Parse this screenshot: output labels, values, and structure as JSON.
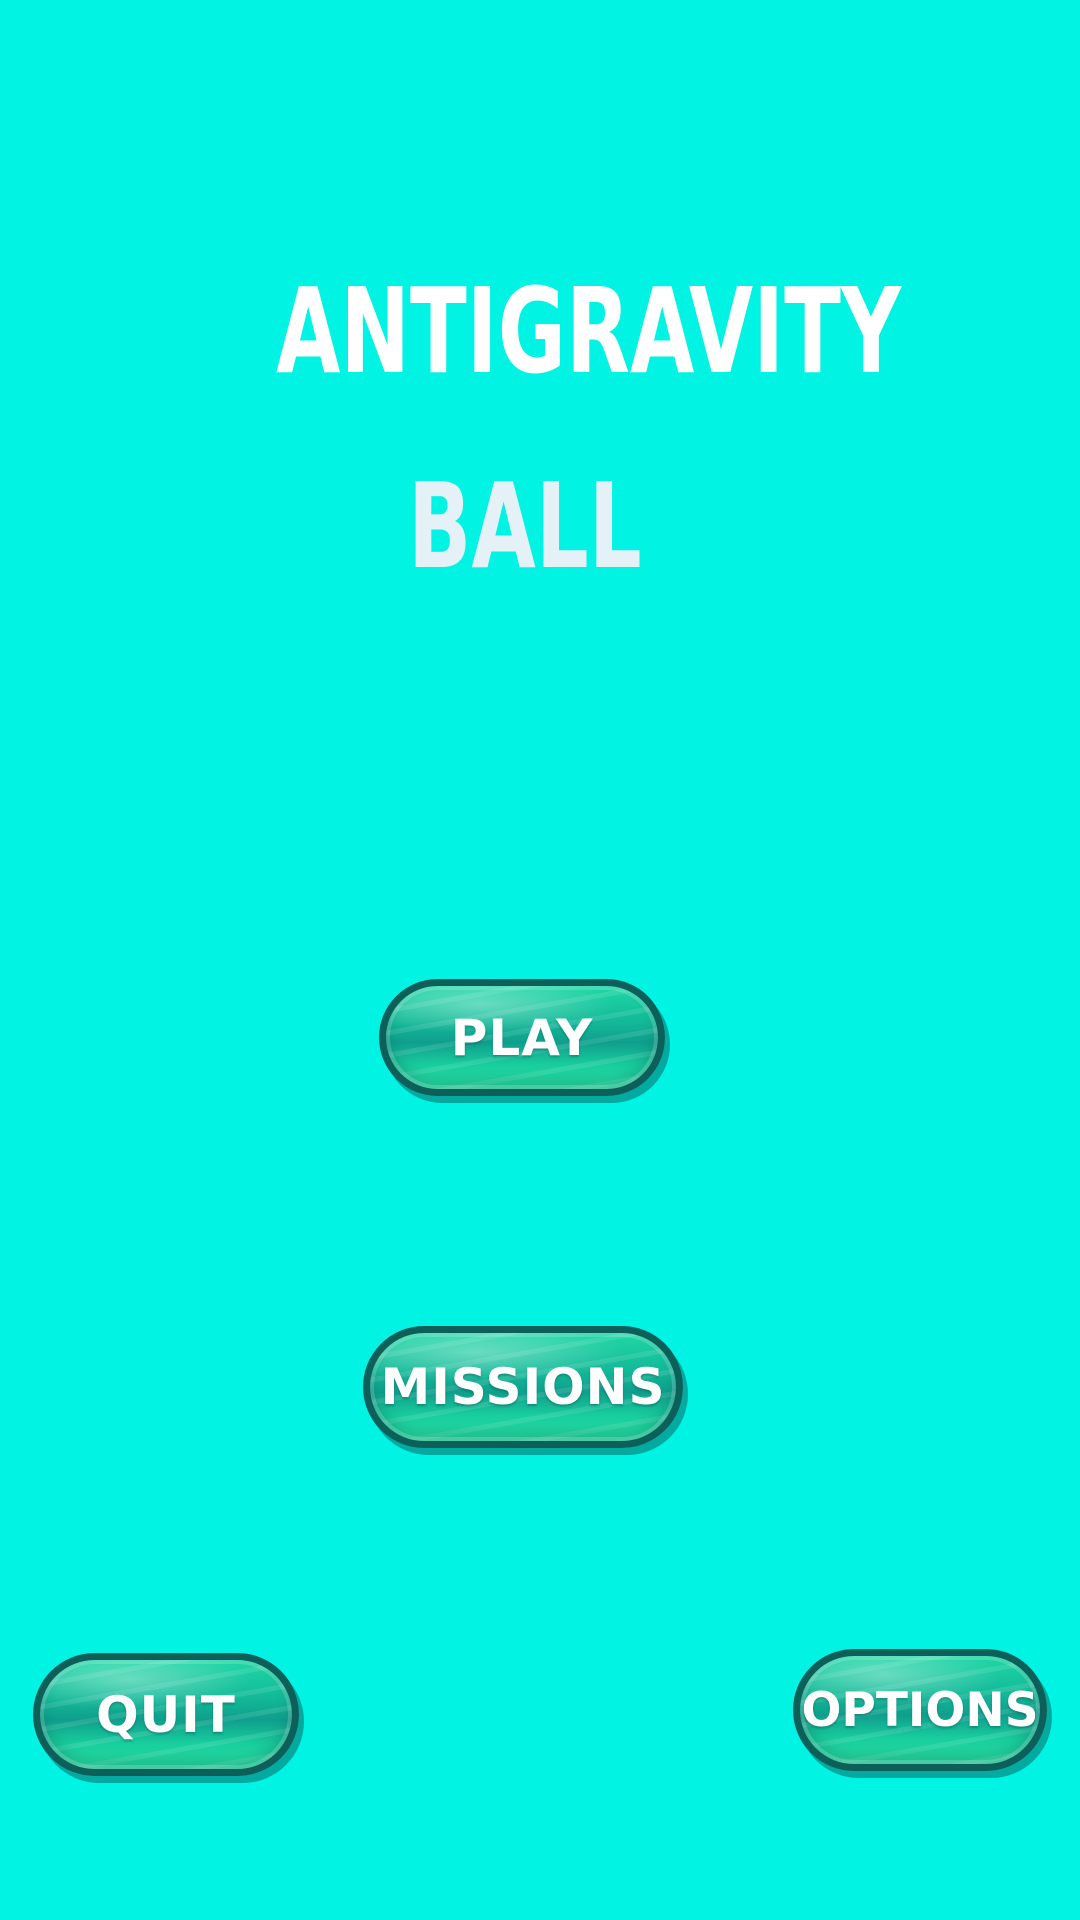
{
  "title": {
    "line1": "ANTIGRAVITY",
    "line2": "BALL"
  },
  "menu": {
    "play_label": "PLAY",
    "missions_label": "MISSIONS",
    "quit_label": "QUIT",
    "options_label": "OPTIONS"
  },
  "colors": {
    "background": "#00f3e3",
    "button_fill": "#13b998",
    "button_border": "#0d5f5a",
    "title_text": "#ffffff"
  }
}
